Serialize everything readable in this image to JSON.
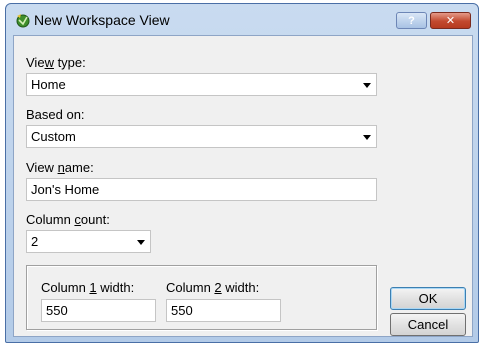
{
  "window": {
    "title": "New Workspace View",
    "help_label": "?",
    "close_label": "✕"
  },
  "view_type": {
    "label_pre": "Vie",
    "label_accel": "w",
    "label_post": " type:",
    "value": "Home"
  },
  "based_on": {
    "label": "Based on:",
    "value": "Custom"
  },
  "view_name": {
    "label_pre": "View ",
    "label_accel": "n",
    "label_post": "ame:",
    "value": "Jon's Home"
  },
  "column_count": {
    "label_pre": "Column ",
    "label_accel": "c",
    "label_post": "ount:",
    "value": "2"
  },
  "column1": {
    "label_pre": "Column ",
    "label_accel": "1",
    "label_post": " width:",
    "value": "550"
  },
  "column2": {
    "label_pre": "Column ",
    "label_accel": "2",
    "label_post": " width:",
    "value": "550"
  },
  "buttons": {
    "ok": "OK",
    "cancel": "Cancel"
  },
  "colors": {
    "title_bar": "#c9dbf0",
    "client_bg": "#f0f0f0",
    "close_button": "#c2492e"
  }
}
